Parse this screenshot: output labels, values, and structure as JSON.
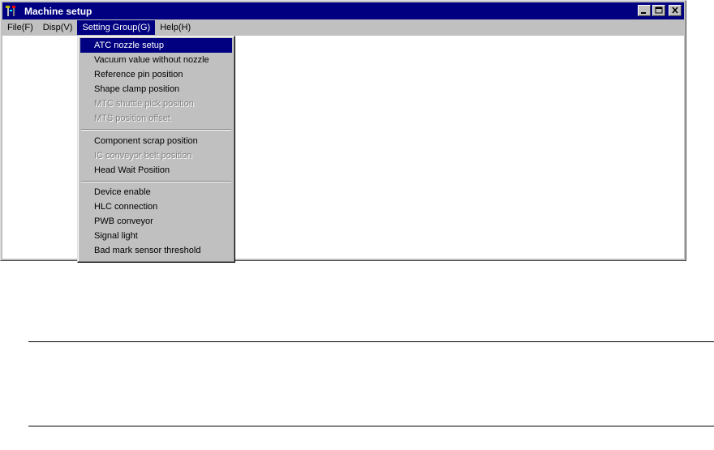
{
  "window": {
    "title": "Machine setup",
    "app_icon": "app-tools-icon"
  },
  "menubar": {
    "items": [
      {
        "label": "File(F)"
      },
      {
        "label": "Disp(V)"
      },
      {
        "label": "Setting Group(G)"
      },
      {
        "label": "Help(H)"
      }
    ]
  },
  "dropdown": {
    "groups": [
      {
        "items": [
          {
            "label": "ATC nozzle setup",
            "state": "highlighted"
          },
          {
            "label": "Vacuum value without nozzle",
            "state": "enabled"
          },
          {
            "label": "Reference pin position",
            "state": "enabled"
          },
          {
            "label": "Shape clamp position",
            "state": "enabled"
          },
          {
            "label": "MTC shuttle pick position",
            "state": "disabled"
          },
          {
            "label": "MTS position offset",
            "state": "disabled"
          }
        ]
      },
      {
        "items": [
          {
            "label": "Component scrap position",
            "state": "enabled"
          },
          {
            "label": "IC conveyor belt position",
            "state": "disabled"
          },
          {
            "label": "Head Wait Position",
            "state": "enabled"
          }
        ]
      },
      {
        "items": [
          {
            "label": "Device enable",
            "state": "enabled"
          },
          {
            "label": "HLC connection",
            "state": "enabled"
          },
          {
            "label": "PWB conveyor",
            "state": "enabled"
          },
          {
            "label": "Signal light",
            "state": "enabled"
          },
          {
            "label": "Bad mark sensor threshold",
            "state": "enabled"
          }
        ]
      }
    ]
  },
  "colors": {
    "titlebar": "#000080",
    "face": "#c0c0c0",
    "highlight": "#000080",
    "disabled": "#808080"
  }
}
